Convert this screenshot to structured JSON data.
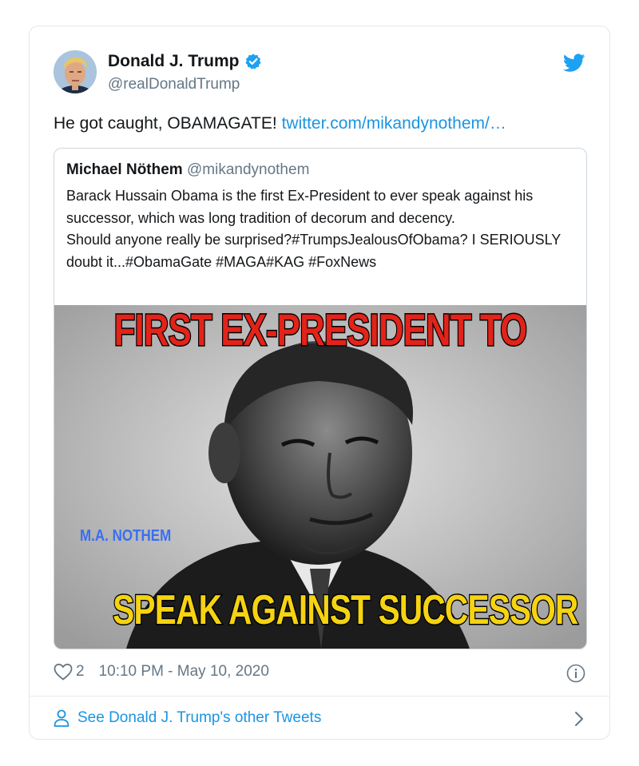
{
  "author": {
    "name": "Donald J. Trump",
    "handle": "@realDonaldTrump"
  },
  "tweet": {
    "text": "He got caught, OBAMAGATE! ",
    "link": "twitter.com/mikandynothem/…"
  },
  "quoted": {
    "name": "Michael Nöthem",
    "handle": "@mikandynothem",
    "line1": "Barack Hussain Obama is the first Ex-President to ever speak against his successor, which was long tradition of decorum and decency.",
    "line2": "Should anyone really be surprised?#TrumpsJealousOfObama? I SERIOUSLY doubt it...#ObamaGate #MAGA#KAG #FoxNews",
    "image": {
      "top_text": "FIRST EX-PRESIDENT TO",
      "bottom_text": "SPEAK AGAINST SUCCESSOR",
      "watermark": "M.A. NOTHEM"
    }
  },
  "footer": {
    "likes": "2",
    "timestamp": "10:10 PM - May 10, 2020",
    "see_more": "See Donald J. Trump's other Tweets"
  },
  "icons": {
    "verified": "verified-badge-icon",
    "bird": "twitter-bird-icon",
    "heart": "heart-icon",
    "info": "info-icon",
    "person": "person-icon",
    "chevron": "chevron-right-icon"
  },
  "colors": {
    "link": "#1b95e0",
    "secondary_text": "#657786",
    "top_text_red": "#e2231a",
    "bottom_text_yellow": "#f5d312"
  }
}
